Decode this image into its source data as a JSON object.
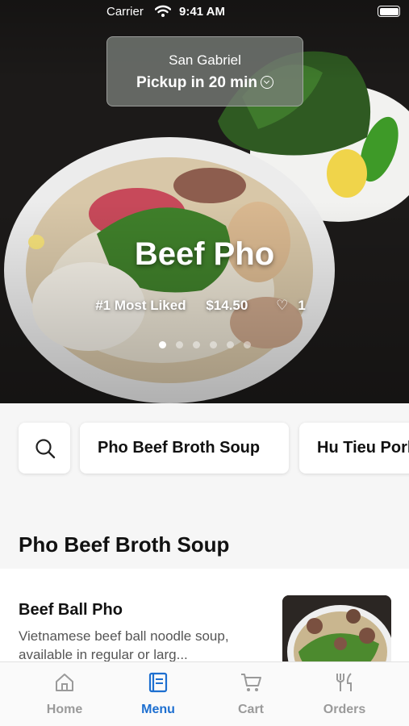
{
  "status_bar": {
    "carrier": "Carrier",
    "time": "9:41 AM"
  },
  "pickup": {
    "location": "San Gabriel",
    "eta": "Pickup in 20 min"
  },
  "featured": {
    "title": "Beef Pho",
    "badge": "#1 Most Liked",
    "price": "$14.50",
    "likes": "1",
    "pages": 6,
    "active_page": 1
  },
  "categories": [
    "Pho Beef Broth Soup",
    "Hu Tieu Pork"
  ],
  "section": {
    "title": "Pho Beef Broth Soup"
  },
  "items": [
    {
      "name": "Beef Ball Pho",
      "description": "Vietnamese beef ball noodle soup, available in regular or larg..."
    }
  ],
  "tabs": [
    {
      "label": "Home",
      "icon": "home-icon",
      "active": false
    },
    {
      "label": "Menu",
      "icon": "menu-book-icon",
      "active": true
    },
    {
      "label": "Cart",
      "icon": "cart-icon",
      "active": false
    },
    {
      "label": "Orders",
      "icon": "fork-knife-icon",
      "active": false
    }
  ],
  "colors": {
    "accent": "#1d6fd0",
    "inactive_tab": "#9a9a9a"
  }
}
